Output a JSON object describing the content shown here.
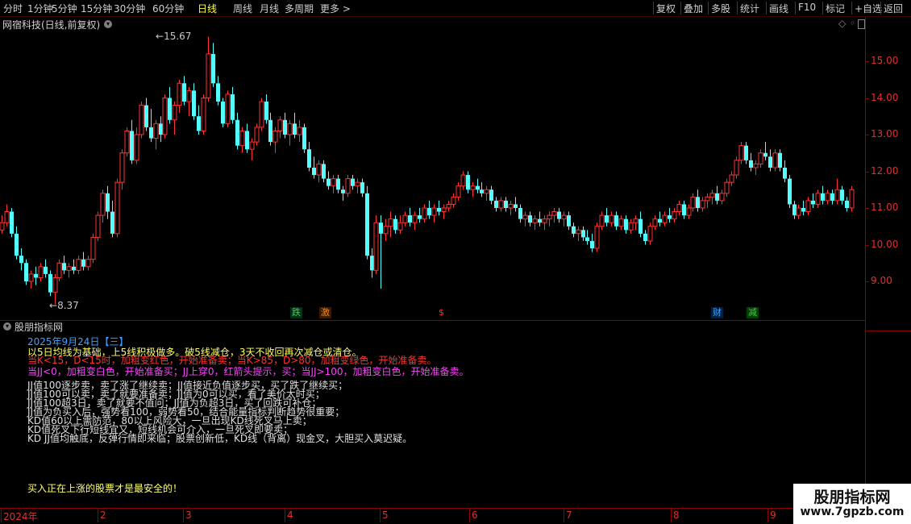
{
  "toolbar": {
    "left_items": [
      "分时",
      "1分钟",
      "5分钟",
      "15分钟",
      "30分钟",
      "60分钟",
      "日线",
      "周线",
      "月线",
      "多周期",
      "更多 >"
    ],
    "active_item": "日线",
    "right_items": [
      "复权",
      "叠加",
      "多股",
      "统计",
      "画线",
      "F10",
      "标记",
      "+自选",
      "返回"
    ]
  },
  "main_chart": {
    "title": "网宿科技(日线,前复权)",
    "high_label": "15.67",
    "low_label": "8.37",
    "y_axis_labels": [
      "15.00",
      "14.00",
      "13.00",
      "12.00",
      "11.00",
      "10.00",
      "9.00"
    ],
    "markers": [
      {
        "text": "跌",
        "color": "#00a050",
        "bg": "#003018"
      },
      {
        "text": "激",
        "color": "#ff8000",
        "bg": "#3a1a00"
      },
      {
        "text": "$",
        "color": "#ff3030",
        "bg": "#000000"
      },
      {
        "text": "财",
        "color": "#40a0ff",
        "bg": "#002040"
      },
      {
        "text": "减",
        "color": "#40d040",
        "bg": "#004000"
      }
    ],
    "colors": {
      "up": "#ff3232",
      "down": "#54ffff",
      "grid": "#8b0000",
      "axis_text": "#e03030"
    }
  },
  "chart_data": {
    "type": "candlestick",
    "ylim": [
      8.1,
      16.2
    ],
    "candles": [
      [
        10.4,
        10.8,
        10.3,
        10.6
      ],
      [
        10.6,
        11.1,
        10.5,
        10.9
      ],
      [
        10.9,
        11.0,
        10.2,
        10.3
      ],
      [
        10.3,
        10.5,
        9.6,
        9.7
      ],
      [
        9.7,
        9.9,
        9.3,
        9.5
      ],
      [
        9.5,
        9.6,
        8.9,
        9.0
      ],
      [
        9.0,
        9.3,
        8.8,
        9.2
      ],
      [
        9.2,
        9.4,
        8.9,
        9.1
      ],
      [
        9.1,
        9.5,
        9.0,
        9.4
      ],
      [
        9.4,
        9.6,
        9.1,
        9.2
      ],
      [
        9.2,
        9.3,
        8.6,
        8.7
      ],
      [
        8.7,
        9.2,
        8.37,
        9.1
      ],
      [
        9.1,
        9.6,
        9.0,
        9.5
      ],
      [
        9.5,
        9.7,
        9.2,
        9.3
      ],
      [
        9.3,
        9.5,
        9.1,
        9.4
      ],
      [
        9.4,
        9.6,
        9.2,
        9.3
      ],
      [
        9.3,
        9.7,
        9.2,
        9.6
      ],
      [
        9.6,
        9.8,
        9.3,
        9.4
      ],
      [
        9.4,
        9.7,
        9.3,
        9.6
      ],
      [
        9.6,
        10.3,
        9.5,
        10.2
      ],
      [
        10.2,
        10.9,
        10.1,
        10.8
      ],
      [
        10.8,
        11.5,
        10.6,
        11.4
      ],
      [
        11.4,
        11.6,
        10.7,
        10.9
      ],
      [
        10.9,
        11.2,
        10.2,
        10.3
      ],
      [
        10.3,
        11.8,
        10.2,
        11.7
      ],
      [
        11.7,
        12.6,
        11.5,
        12.5
      ],
      [
        12.5,
        13.2,
        12.4,
        13.1
      ],
      [
        13.1,
        13.4,
        12.2,
        12.3
      ],
      [
        12.3,
        13.2,
        12.2,
        13.0
      ],
      [
        13.0,
        13.9,
        12.9,
        13.8
      ],
      [
        13.8,
        14.0,
        13.1,
        13.2
      ],
      [
        13.2,
        13.7,
        12.8,
        12.9
      ],
      [
        12.9,
        13.4,
        12.6,
        13.3
      ],
      [
        13.3,
        13.5,
        12.8,
        13.0
      ],
      [
        13.0,
        14.1,
        12.9,
        14.0
      ],
      [
        14.0,
        14.3,
        13.3,
        13.4
      ],
      [
        13.4,
        13.9,
        13.0,
        13.8
      ],
      [
        13.8,
        14.5,
        13.6,
        14.4
      ],
      [
        14.4,
        14.6,
        13.8,
        13.9
      ],
      [
        13.9,
        14.3,
        13.5,
        14.2
      ],
      [
        14.2,
        14.4,
        13.4,
        13.5
      ],
      [
        13.5,
        13.8,
        13.0,
        13.1
      ],
      [
        13.1,
        14.1,
        13.0,
        14.0
      ],
      [
        14.0,
        15.67,
        13.9,
        15.2
      ],
      [
        15.2,
        15.5,
        14.3,
        14.4
      ],
      [
        14.4,
        14.6,
        13.8,
        13.9
      ],
      [
        13.9,
        14.0,
        13.2,
        13.3
      ],
      [
        13.3,
        14.2,
        13.2,
        14.1
      ],
      [
        14.1,
        14.3,
        13.3,
        13.4
      ],
      [
        13.4,
        13.6,
        12.6,
        12.7
      ],
      [
        12.7,
        13.2,
        12.5,
        13.1
      ],
      [
        13.1,
        13.3,
        12.5,
        12.6
      ],
      [
        12.6,
        12.9,
        12.3,
        12.8
      ],
      [
        12.8,
        13.3,
        12.7,
        13.2
      ],
      [
        13.2,
        14.0,
        13.1,
        13.9
      ],
      [
        13.9,
        14.1,
        13.3,
        13.4
      ],
      [
        13.4,
        13.6,
        12.7,
        12.8
      ],
      [
        12.8,
        13.2,
        12.5,
        13.1
      ],
      [
        13.1,
        13.5,
        12.9,
        13.4
      ],
      [
        13.4,
        13.6,
        12.9,
        13.0
      ],
      [
        13.0,
        13.4,
        12.7,
        13.3
      ],
      [
        13.3,
        13.6,
        12.9,
        13.0
      ],
      [
        13.0,
        13.4,
        12.8,
        13.2
      ],
      [
        13.2,
        13.3,
        12.5,
        12.6
      ],
      [
        12.6,
        12.8,
        12.0,
        12.1
      ],
      [
        12.1,
        12.4,
        11.8,
        11.9
      ],
      [
        11.9,
        12.3,
        11.7,
        12.2
      ],
      [
        12.2,
        12.3,
        11.7,
        11.8
      ],
      [
        11.8,
        12.0,
        11.5,
        11.6
      ],
      [
        11.6,
        11.9,
        11.4,
        11.8
      ],
      [
        11.8,
        11.9,
        11.4,
        11.5
      ],
      [
        11.5,
        11.6,
        11.2,
        11.4
      ],
      [
        11.4,
        11.9,
        11.3,
        11.8
      ],
      [
        11.8,
        11.9,
        11.5,
        11.6
      ],
      [
        11.6,
        11.8,
        11.4,
        11.7
      ],
      [
        11.7,
        11.8,
        11.3,
        11.4
      ],
      [
        11.4,
        11.6,
        9.6,
        9.7
      ],
      [
        9.7,
        9.9,
        9.1,
        9.3
      ],
      [
        9.3,
        10.8,
        9.2,
        10.6
      ],
      [
        10.6,
        10.8,
        8.8,
        10.3
      ],
      [
        10.3,
        10.7,
        10.1,
        10.5
      ],
      [
        10.5,
        10.9,
        10.2,
        10.7
      ],
      [
        10.7,
        10.8,
        10.3,
        10.4
      ],
      [
        10.4,
        10.8,
        10.3,
        10.6
      ],
      [
        10.6,
        10.9,
        10.5,
        10.8
      ],
      [
        10.8,
        11.0,
        10.5,
        10.6
      ],
      [
        10.6,
        10.9,
        10.4,
        10.8
      ],
      [
        10.8,
        11.0,
        10.6,
        10.7
      ],
      [
        10.7,
        11.1,
        10.6,
        11.0
      ],
      [
        11.0,
        11.2,
        10.7,
        10.8
      ],
      [
        10.8,
        11.1,
        10.6,
        11.0
      ],
      [
        11.0,
        11.2,
        10.8,
        10.9
      ],
      [
        10.9,
        11.1,
        10.7,
        11.0
      ],
      [
        11.0,
        11.2,
        10.9,
        11.1
      ],
      [
        11.1,
        11.4,
        11.0,
        11.3
      ],
      [
        11.3,
        11.7,
        11.2,
        11.6
      ],
      [
        11.6,
        12.0,
        11.5,
        11.9
      ],
      [
        11.9,
        12.0,
        11.4,
        11.5
      ],
      [
        11.5,
        11.7,
        11.3,
        11.6
      ],
      [
        11.6,
        11.8,
        11.4,
        11.5
      ],
      [
        11.5,
        11.7,
        11.3,
        11.4
      ],
      [
        11.4,
        11.6,
        11.2,
        11.5
      ],
      [
        11.5,
        11.6,
        11.1,
        11.2
      ],
      [
        11.2,
        11.3,
        10.9,
        11.0
      ],
      [
        11.0,
        11.3,
        10.9,
        11.2
      ],
      [
        11.2,
        11.3,
        10.9,
        11.0
      ],
      [
        11.0,
        11.2,
        10.8,
        11.1
      ],
      [
        11.1,
        11.3,
        10.9,
        11.0
      ],
      [
        11.0,
        11.1,
        10.6,
        10.7
      ],
      [
        10.7,
        10.9,
        10.5,
        10.8
      ],
      [
        10.8,
        10.9,
        10.5,
        10.6
      ],
      [
        10.6,
        10.8,
        10.4,
        10.7
      ],
      [
        10.7,
        10.9,
        10.5,
        10.6
      ],
      [
        10.6,
        10.8,
        10.4,
        10.7
      ],
      [
        10.7,
        10.9,
        10.5,
        10.8
      ],
      [
        10.8,
        11.0,
        10.6,
        10.9
      ],
      [
        10.9,
        11.0,
        10.6,
        10.7
      ],
      [
        10.7,
        10.9,
        10.5,
        10.8
      ],
      [
        10.8,
        10.9,
        10.4,
        10.5
      ],
      [
        10.5,
        10.6,
        10.2,
        10.3
      ],
      [
        10.3,
        10.5,
        10.1,
        10.4
      ],
      [
        10.4,
        10.5,
        10.1,
        10.2
      ],
      [
        10.2,
        10.4,
        10.0,
        10.1
      ],
      [
        10.1,
        10.3,
        9.8,
        9.9
      ],
      [
        9.9,
        10.6,
        9.8,
        10.5
      ],
      [
        10.5,
        10.9,
        10.4,
        10.8
      ],
      [
        10.8,
        11.0,
        10.5,
        10.6
      ],
      [
        10.6,
        10.9,
        10.5,
        10.8
      ],
      [
        10.8,
        10.9,
        10.4,
        10.5
      ],
      [
        10.5,
        10.8,
        10.4,
        10.7
      ],
      [
        10.7,
        10.8,
        10.3,
        10.4
      ],
      [
        10.4,
        10.7,
        10.3,
        10.6
      ],
      [
        10.6,
        10.8,
        10.4,
        10.7
      ],
      [
        10.7,
        10.9,
        10.2,
        10.3
      ],
      [
        10.3,
        10.4,
        10.0,
        10.1
      ],
      [
        10.1,
        10.6,
        10.0,
        10.5
      ],
      [
        10.5,
        10.8,
        10.4,
        10.7
      ],
      [
        10.7,
        10.9,
        10.5,
        10.6
      ],
      [
        10.6,
        10.9,
        10.5,
        10.8
      ],
      [
        10.8,
        11.0,
        10.6,
        10.7
      ],
      [
        10.7,
        11.0,
        10.6,
        10.9
      ],
      [
        10.9,
        11.2,
        10.8,
        11.1
      ],
      [
        11.1,
        11.2,
        10.7,
        10.8
      ],
      [
        10.8,
        11.1,
        10.7,
        11.0
      ],
      [
        11.0,
        11.4,
        10.9,
        11.3
      ],
      [
        11.3,
        11.5,
        10.9,
        11.0
      ],
      [
        11.0,
        11.3,
        10.9,
        11.2
      ],
      [
        11.2,
        11.4,
        11.0,
        11.3
      ],
      [
        11.3,
        11.5,
        11.1,
        11.4
      ],
      [
        11.4,
        11.6,
        11.1,
        11.2
      ],
      [
        11.2,
        11.5,
        11.1,
        11.4
      ],
      [
        11.4,
        11.8,
        11.3,
        11.7
      ],
      [
        11.7,
        12.0,
        11.6,
        11.9
      ],
      [
        11.9,
        12.4,
        11.8,
        12.3
      ],
      [
        12.3,
        12.8,
        12.2,
        12.7
      ],
      [
        12.7,
        12.8,
        12.2,
        12.3
      ],
      [
        12.3,
        12.5,
        12.0,
        12.1
      ],
      [
        12.1,
        12.3,
        11.9,
        12.2
      ],
      [
        12.2,
        12.6,
        12.1,
        12.5
      ],
      [
        12.5,
        12.8,
        12.3,
        12.4
      ],
      [
        12.4,
        12.6,
        12.0,
        12.1
      ],
      [
        12.1,
        12.6,
        12.0,
        12.5
      ],
      [
        12.5,
        12.6,
        12.0,
        12.1
      ],
      [
        12.1,
        12.3,
        11.7,
        11.8
      ],
      [
        11.8,
        11.9,
        11.0,
        11.1
      ],
      [
        11.1,
        11.2,
        10.7,
        10.8
      ],
      [
        10.8,
        11.1,
        10.7,
        11.0
      ],
      [
        11.0,
        11.2,
        10.8,
        10.9
      ],
      [
        10.9,
        11.3,
        10.8,
        11.2
      ],
      [
        11.2,
        11.4,
        11.0,
        11.1
      ],
      [
        11.1,
        11.5,
        11.0,
        11.4
      ],
      [
        11.4,
        11.6,
        11.1,
        11.2
      ],
      [
        11.2,
        11.5,
        11.1,
        11.4
      ],
      [
        11.4,
        11.5,
        11.1,
        11.2
      ],
      [
        11.2,
        11.8,
        11.1,
        11.5
      ],
      [
        11.5,
        11.6,
        11.1,
        11.2
      ],
      [
        11.2,
        11.3,
        10.9,
        11.0
      ],
      [
        11.0,
        11.6,
        10.9,
        11.5
      ]
    ]
  },
  "indicator_panel": {
    "title": "股朋指标网",
    "date_line": "2025年9月24日【三】",
    "lines": [
      {
        "text": "以5日均线为基础，上5线积极做多。破5线减仓，3天不收回再次减仓或清仓。",
        "color": "#ffff66"
      },
      {
        "text": "当K<15，D<15时，加粗变红色，开始准备卖；当K>85，D>80，加粗变绿色，开始准备卖。",
        "color": "#ff3030"
      },
      {
        "text": "当JJ<0，加粗变白色，开始准备买；JJ上穿0，红箭头提示，买；当JJ>100，加粗变白色，开始准备卖。",
        "color": "#ff40ff"
      },
      {
        "text": "JJ值100逐步卖，卖了涨了继续卖；JJ值接近负值逐步买，买了跌了继续买；",
        "color": "#e0e0e0"
      },
      {
        "text": "JJ值100可以卖，卖了就要准备卖；JJ值为0可以买，看了美价太时买；",
        "color": "#e0e0e0"
      },
      {
        "text": "JJ值100超3日，卖了就要不值问；JJ值为负超3日，买了回跌可补仓；",
        "color": "#e0e0e0"
      },
      {
        "text": "JJ值为负买入后，强势看100，弱势看50，结合能量指标判断趋势很重要；",
        "color": "#e0e0e0"
      },
      {
        "text": "KD值60以上需防范，80以上风险大，一旦出现KD线死叉马上卖；",
        "color": "#e0e0e0"
      },
      {
        "text": "KD值死叉下行短线宜又，短线机会可介入，一旦死叉即要卖；",
        "color": "#e0e0e0"
      },
      {
        "text": "KD JJ值均触底，反弹行情即来临；股票创新低，KD线（背离）现金叉，大胆买入莫迟疑。",
        "color": "#e0e0e0"
      }
    ],
    "footer_text": "买入正在上涨的股票才是最安全的！"
  },
  "time_axis": {
    "labels": [
      "2024年",
      "2",
      "3",
      "4",
      "5",
      "6",
      "7",
      "8",
      "9"
    ]
  },
  "watermark": {
    "line1": "股朋指标网",
    "line2": "www.7gpzb.com"
  }
}
